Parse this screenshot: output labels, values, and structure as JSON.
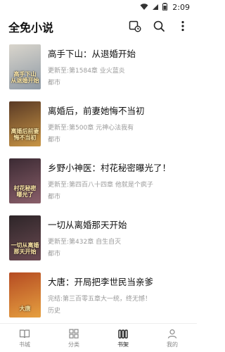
{
  "status": {
    "time": "2:09"
  },
  "app": {
    "title": "全免小说"
  },
  "books": [
    {
      "title": "高手下山：从退婚开始",
      "update": "更新至:第1584章 业火蓝炎",
      "category": "都市",
      "cover_text": "高手下山 从退婚开始",
      "cover_colors": [
        "#d9d5cc",
        "#8f9aa5"
      ]
    },
    {
      "title": "离婚后，前妻她悔不当初",
      "update": "更新至:第500章 元神心法我有",
      "category": "都市",
      "cover_text": "离婚后前妻 悔不当初",
      "cover_colors": [
        "#5a3a25",
        "#c89545"
      ]
    },
    {
      "title": "乡野小神医：村花秘密曝光了！",
      "update": "更新至:第四百八十四章 他就是个疯子",
      "category": "都市",
      "cover_text": "村花秘密 曝光了",
      "cover_colors": [
        "#3b2a33",
        "#8a5f6a"
      ]
    },
    {
      "title": "一切从离婚那天开始",
      "update": "更新至:第432章 自生自灭",
      "category": "都市",
      "cover_text": "一切从离婚 那天开始",
      "cover_colors": [
        "#2d2528",
        "#6b4a52"
      ]
    },
    {
      "title": "大唐：开局把李世民当亲爹",
      "update": "完结:第三百零五章大一统，终无憾！",
      "category": "历史",
      "cover_text": "大唐",
      "cover_colors": [
        "#b54b22",
        "#e6a040"
      ]
    }
  ],
  "nav": [
    {
      "label": "书城",
      "icon": "book-open-icon",
      "active": false
    },
    {
      "label": "分类",
      "icon": "grid-icon",
      "active": false
    },
    {
      "label": "书架",
      "icon": "bookshelf-icon",
      "active": true
    },
    {
      "label": "我的",
      "icon": "user-icon",
      "active": false
    }
  ]
}
